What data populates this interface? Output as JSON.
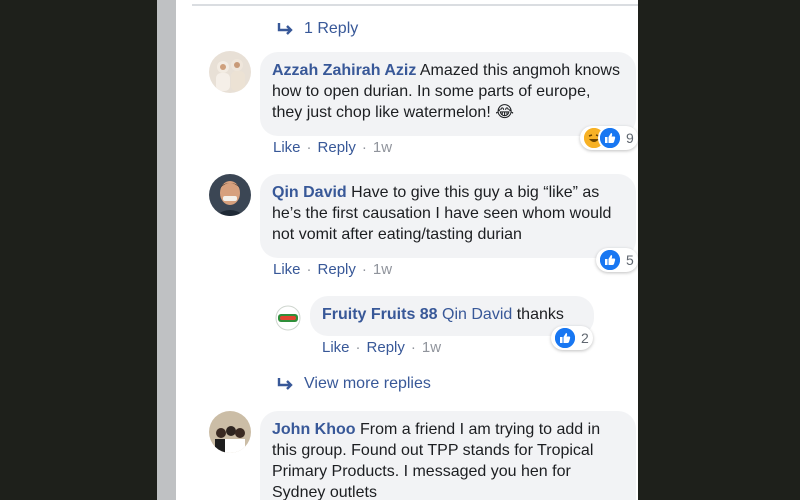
{
  "thread": {
    "top_replies_link": "1 Reply",
    "view_more_replies": "View more replies"
  },
  "actions": {
    "like": "Like",
    "reply": "Reply",
    "sep": "·"
  },
  "comments": [
    {
      "author": "Azzah Zahirah Aziz",
      "text": "Amazed this angmoh knows how to open durian. In some parts of europe, they just chop like watermelon! 😂",
      "time": "1w",
      "reactions": [
        "laugh",
        "like"
      ],
      "reaction_count": "9"
    },
    {
      "author": "Qin David",
      "text": "Have to give this guy a big “like” as he’s the first causation I have seen whom would not vomit after eating/tasting durian",
      "time": "1w",
      "reactions": [
        "like"
      ],
      "reaction_count": "5",
      "replies": [
        {
          "author": "Fruity Fruits 88",
          "mention": "Qin David",
          "text": "thanks",
          "time": "1w",
          "reactions": [
            "like"
          ],
          "reaction_count": "2"
        }
      ]
    },
    {
      "author": "John Khoo",
      "text": "From a friend I am trying to add in this group. Found out TPP stands for Tropical Primary Products. I messaged you hen for Sydney outlets"
    }
  ],
  "colors": {
    "link": "#385898",
    "bubble": "#f2f3f5",
    "like_blue": "#1877f2",
    "meta_gray": "#90949c"
  }
}
